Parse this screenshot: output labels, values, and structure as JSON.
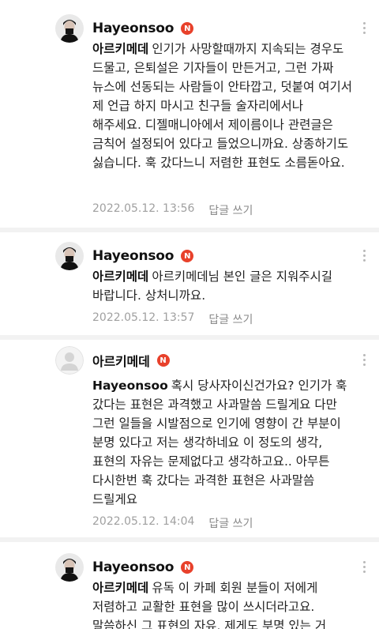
{
  "comments": [
    {
      "author": "Hayeonsoo",
      "badge": "N",
      "mention": "아르키메데",
      "text": "인기가 사망할때까지 지속되는 경우도 드물고, 은퇴설은 기자들이 만든거고, 그런 가짜 뉴스에 선동되는 사람들이 안타깝고, 덧붙여 여기서 제 언급 하지 마시고 친구들 술자리에서나 해주세요. 디젤매니아에서 제이름이나 관련글은 금칙어 설정되어 있다고 들었으니까요. 상종하기도 싫습니다. 훅 갔다느니 저렴한 표현도 소름돋아요.",
      "date": "2022.05.12. 13:56",
      "reply_label": "답글 쓰기"
    },
    {
      "author": "Hayeonsoo",
      "badge": "N",
      "mention": "아르키메데",
      "text": "아르키메데님 본인 글은 지워주시길 바랍니다. 상처니까요.",
      "date": "2022.05.12. 13:57",
      "reply_label": "답글 쓰기"
    },
    {
      "author": "아르키메데",
      "badge": "N",
      "mention": "Hayeonsoo",
      "text": "혹시 당사자이신건가요? 인기가 훅 갔다는 표현은 과격했고 사과말씀 드릴게요 다만 그런 일들을 시발점으로 인기에 영향이 간 부분이 분명 있다고 저는 생각하네요 이 정도의 생각, 표현의 자유는 문제없다고 생각하고요.. 아무튼 다시한번 훅 갔다는 과격한 표현은 사과말씀 드릴게요",
      "date": "2022.05.12. 14:04",
      "reply_label": "답글 쓰기"
    },
    {
      "author": "Hayeonsoo",
      "badge": "N",
      "mention": "아르키메데",
      "text": "유독 이 카페 회원 분들이 저에게 저렴하고 교활한 표현을 많이 쓰시더라고요. 말씀하신 그 표현의 자유, 제게도 부명 있는 거",
      "date": "",
      "reply_label": ""
    }
  ]
}
